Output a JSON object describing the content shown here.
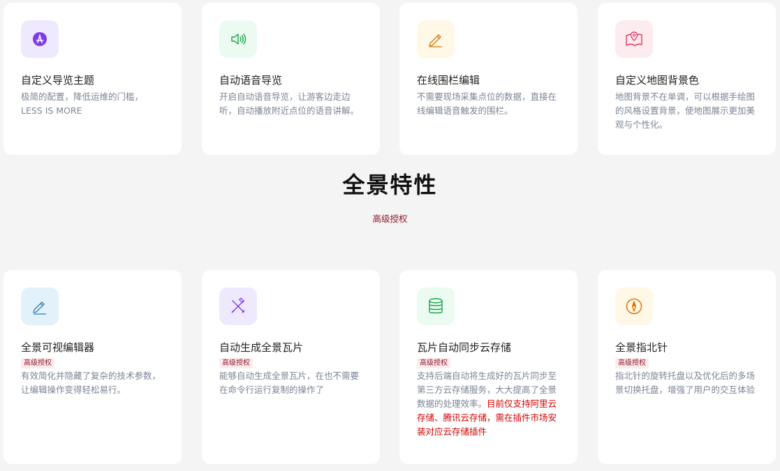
{
  "top_cards": [
    {
      "icon": "app-store-icon",
      "title": "自定义导览主题",
      "desc": "极简的配置，降低运维的门槛，LESS IS MORE"
    },
    {
      "icon": "speaker-icon",
      "title": "自动语音导览",
      "desc": "开启自动语音导览，让游客边走边听，自动播放附近点位的语音讲解。"
    },
    {
      "icon": "pencil-icon",
      "title": "在线围栏编辑",
      "desc": "不需要现场采集点位的数据，直接在线编辑语音触发的围栏。"
    },
    {
      "icon": "map-pin-icon",
      "title": "自定义地图背景色",
      "desc": "地图背景不在单调，可以根据手绘图的风格设置背景，使地图展示更加美观与个性化。"
    }
  ],
  "section": {
    "title": "全景特性",
    "subtitle": "高级授权"
  },
  "bottom_cards": [
    {
      "icon": "edit-icon",
      "title": "全景可视编辑器",
      "badge": "高级授权",
      "desc": "有效简化并隐藏了复杂的技术参数，让编辑操作变得轻松易行。",
      "desc_highlight": ""
    },
    {
      "icon": "tools-icon",
      "title": "自动生成全景瓦片",
      "badge": "高级授权",
      "desc": "能够自动生成全景瓦片，在也不需要在命令行运行复制的操作了",
      "desc_highlight": ""
    },
    {
      "icon": "database-icon",
      "title": "瓦片自动同步云存储",
      "badge": "高级授权",
      "desc": "支持后端自动将生成好的瓦片同步至第三方云存储服务，大大提高了全景数据的处理效率。",
      "desc_highlight": "目前仅支持阿里云存储、腾讯云存储，需在插件市场安装对应云存储插件"
    },
    {
      "icon": "compass-icon",
      "title": "全景指北针",
      "badge": "高级授权",
      "desc": "指北针的旋转托盘以及优化后的多场景切换托盘，增强了用户的交互体验",
      "desc_highlight": ""
    }
  ],
  "colors": {
    "purple_bg": "#efe9fd",
    "purple": "#7c3aed",
    "green_bg": "#ecfbf1",
    "green": "#16a34a",
    "yellow_bg": "#fff8e6",
    "yellow": "#d97706",
    "pink_bg": "#fdecef",
    "pink": "#e11d48",
    "blue_bg": "#e3f1fb",
    "blue": "#2b7db8",
    "badge_text": "#8b1a2b",
    "highlight": "#d40000"
  }
}
